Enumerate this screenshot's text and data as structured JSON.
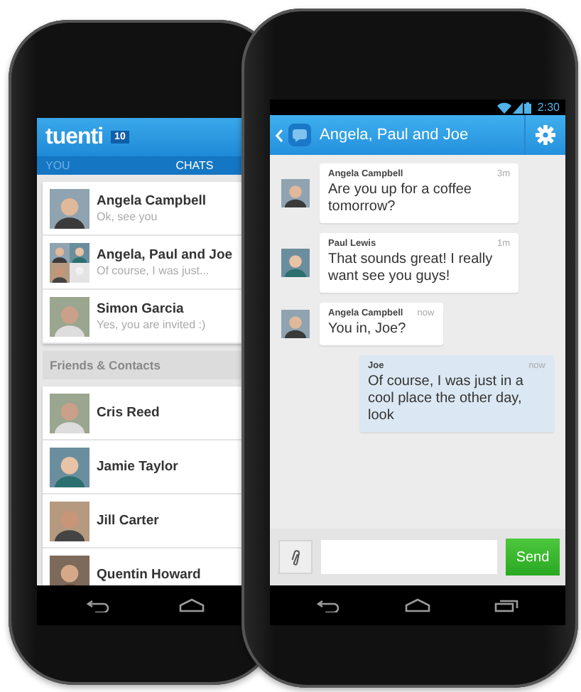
{
  "back_phone": {
    "app_name": "tuenti",
    "badge": "10",
    "tabs": [
      {
        "label": "YOU",
        "selected": false
      },
      {
        "label": "CHATS",
        "selected": true
      }
    ],
    "chats": [
      {
        "name": "Angela Campbell",
        "preview": "Ok, see you",
        "kind": "single"
      },
      {
        "name": "Angela, Paul and Joe",
        "preview": "Of course, I was just...",
        "kind": "group"
      },
      {
        "name": "Simon Garcia",
        "preview": "Yes, you are invited :)",
        "kind": "single"
      }
    ],
    "section_title": "Friends & Contacts",
    "contacts": [
      {
        "name": "Cris Reed"
      },
      {
        "name": "Jamie Taylor"
      },
      {
        "name": "Jill Carter"
      },
      {
        "name": "Quentin Howard"
      }
    ]
  },
  "front_phone": {
    "status_time": "2:30",
    "title": "Angela, Paul and Joe",
    "messages": [
      {
        "sender": "Angela Campbell",
        "time": "3m",
        "text": "Are you up for a coffee tomorrow?",
        "outgoing": false
      },
      {
        "sender": "Paul Lewis",
        "time": "1m",
        "text": "That sounds great! I really want see you guys!",
        "outgoing": false
      },
      {
        "sender": "Angela Campbell",
        "time": "now",
        "text": "You in, Joe?",
        "outgoing": false
      },
      {
        "sender": "Joe",
        "time": "now",
        "text": "Of course, I was just in a cool place the other day, look",
        "outgoing": true
      }
    ],
    "send_label": "Send"
  }
}
